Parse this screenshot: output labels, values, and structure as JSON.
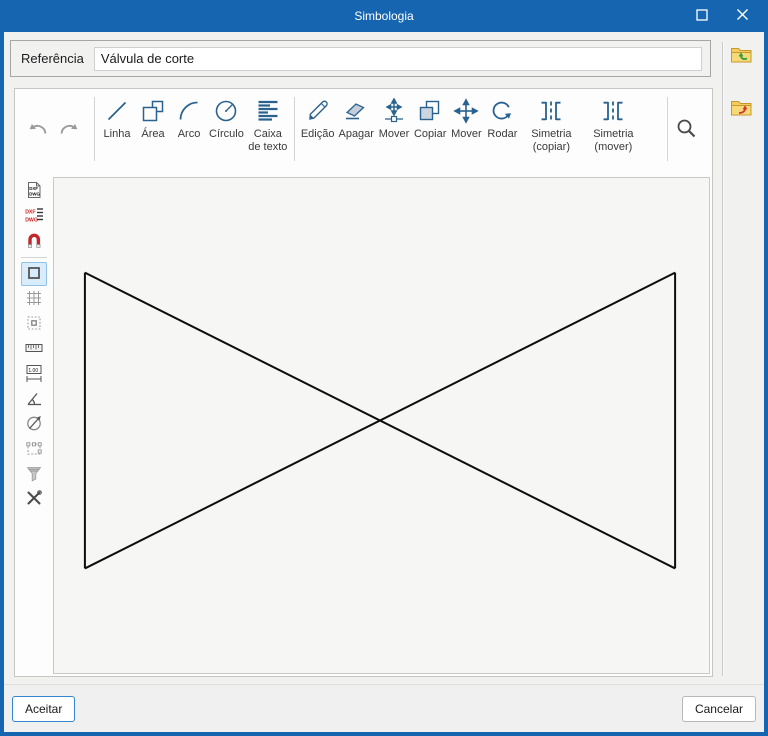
{
  "window": {
    "title": "Simbologia"
  },
  "reference": {
    "label": "Referência",
    "value": "Válvula de corte"
  },
  "side_buttons": [
    {
      "name": "open-symbol",
      "icon": "folder-open-icon"
    },
    {
      "name": "save-symbol",
      "icon": "folder-save-icon"
    }
  ],
  "toolbar": {
    "history": [
      {
        "name": "undo",
        "icon": "undo-icon"
      },
      {
        "name": "redo",
        "icon": "redo-icon"
      }
    ],
    "groups": [
      {
        "name": "draw",
        "tools": [
          {
            "label": "Linha",
            "icon": "line-icon"
          },
          {
            "label": "Área",
            "icon": "area-icon"
          },
          {
            "label": "Arco",
            "icon": "arc-icon"
          },
          {
            "label": "Círculo",
            "icon": "circle-icon"
          },
          {
            "label": "Caixa de texto",
            "icon": "textbox-icon"
          }
        ]
      },
      {
        "name": "edit",
        "tools": [
          {
            "label": "Edição",
            "icon": "pencil-icon"
          },
          {
            "label": "Apagar",
            "icon": "eraser-icon"
          },
          {
            "label": "Mover",
            "icon": "move-node-icon"
          },
          {
            "label": "Copiar",
            "icon": "copy-icon"
          },
          {
            "label": "Mover",
            "icon": "move-icon"
          },
          {
            "label": "Rodar",
            "icon": "rotate-icon"
          },
          {
            "label": "Simetria (copiar)",
            "icon": "mirror-copy-icon"
          },
          {
            "label": "Simetria (mover)",
            "icon": "mirror-move-icon"
          }
        ]
      }
    ],
    "search": {
      "name": "zoom-search",
      "icon": "magnifier-icon"
    }
  },
  "left_toolbar": {
    "selected_index": 3,
    "items": [
      {
        "name": "import-dxf-dwg",
        "icon": "dxf-dwg-document-icon",
        "selected": false
      },
      {
        "name": "export-dxf-dwg",
        "icon": "dxf-dwg-layers-icon",
        "selected": false
      },
      {
        "name": "snap-magnet",
        "icon": "magnet-icon",
        "selected": false
      },
      {
        "name": "show-frame",
        "icon": "square-icon",
        "selected": true
      },
      {
        "name": "show-grid",
        "icon": "grid-icon",
        "selected": false
      },
      {
        "name": "snap-to-grid",
        "icon": "snap-grid-icon",
        "selected": false
      },
      {
        "name": "ruler",
        "icon": "ruler-icon",
        "selected": false
      },
      {
        "name": "dimension",
        "icon": "dimension-1-00-icon",
        "selected": false
      },
      {
        "name": "angle",
        "icon": "angle-icon",
        "selected": false
      },
      {
        "name": "rotate-view",
        "icon": "circle-arrow-icon",
        "selected": false
      },
      {
        "name": "selection",
        "icon": "selection-rect-icon",
        "selected": false
      },
      {
        "name": "filter",
        "icon": "funnel-icon",
        "selected": false
      },
      {
        "name": "tools",
        "icon": "crossed-tools-icon",
        "selected": false
      }
    ]
  },
  "canvas": {
    "symbol_name": "bowtie-valve-symbol",
    "view_width": 657,
    "view_height": 497,
    "stroke": "#0d0d0d",
    "stroke_width": 2,
    "lines": [
      [
        31,
        95,
        31,
        392
      ],
      [
        623,
        95,
        623,
        392
      ],
      [
        31,
        95,
        623,
        392
      ],
      [
        623,
        95,
        31,
        392
      ]
    ]
  },
  "footer": {
    "accept": "Aceitar",
    "cancel": "Cancelar"
  },
  "colors": {
    "titlebar": "#1565b0",
    "icon_blue": "#2a628f",
    "canvas_bg": "#f6f6f5",
    "selected_item_bg": "#d9ecfb"
  }
}
